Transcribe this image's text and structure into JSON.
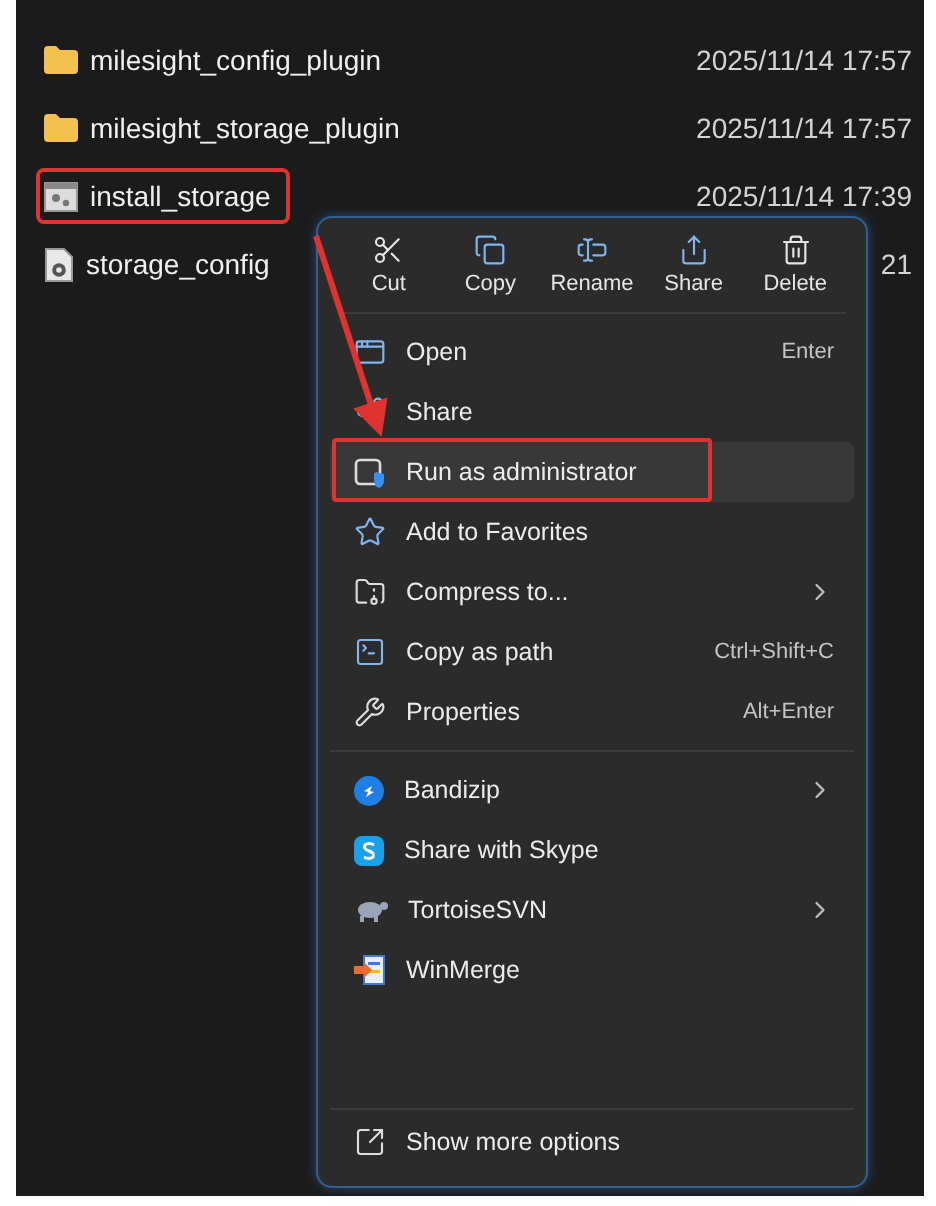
{
  "files": [
    {
      "name": "milesight_config_plugin",
      "date": "2025/11/14 17:57",
      "kind": "folder",
      "annotated": false
    },
    {
      "name": "milesight_storage_plugin",
      "date": "2025/11/14 17:57",
      "kind": "folder",
      "annotated": false
    },
    {
      "name": "install_storage",
      "date": "2025/11/14 17:39",
      "kind": "script",
      "annotated": true
    },
    {
      "name": "storage_config",
      "date": "21",
      "kind": "config",
      "annotated": false
    }
  ],
  "context_menu": {
    "actions": [
      {
        "label": "Cut",
        "kind": "cut"
      },
      {
        "label": "Copy",
        "kind": "copy"
      },
      {
        "label": "Rename",
        "kind": "rename"
      },
      {
        "label": "Share",
        "kind": "share"
      },
      {
        "label": "Delete",
        "kind": "delete"
      }
    ],
    "sections": [
      [
        {
          "label": "Open",
          "shortcut": "Enter",
          "kind": "open",
          "highlighted": false,
          "annotated": false,
          "submenu": false
        },
        {
          "label": "Share",
          "kind": "share",
          "highlighted": false,
          "annotated": false,
          "submenu": false
        },
        {
          "label": "Run as administrator",
          "kind": "admin",
          "highlighted": true,
          "annotated": true,
          "submenu": false
        },
        {
          "label": "Add to Favorites",
          "kind": "star",
          "highlighted": false,
          "annotated": false,
          "submenu": false
        },
        {
          "label": "Compress to...",
          "kind": "compress",
          "highlighted": false,
          "annotated": false,
          "submenu": true
        },
        {
          "label": "Copy as path",
          "shortcut": "Ctrl+Shift+C",
          "kind": "path",
          "highlighted": false,
          "annotated": false,
          "submenu": false
        },
        {
          "label": "Properties",
          "shortcut": "Alt+Enter",
          "kind": "properties",
          "highlighted": false,
          "annotated": false,
          "submenu": false
        }
      ],
      [
        {
          "label": "Bandizip",
          "kind": "bandizip",
          "highlighted": false,
          "annotated": false,
          "submenu": true
        },
        {
          "label": "Share with Skype",
          "kind": "skype",
          "highlighted": false,
          "annotated": false,
          "submenu": false
        },
        {
          "label": "TortoiseSVN",
          "kind": "tortoise",
          "highlighted": false,
          "annotated": false,
          "submenu": true
        },
        {
          "label": "WinMerge",
          "kind": "winmerge",
          "highlighted": false,
          "annotated": false,
          "submenu": false
        }
      ]
    ],
    "footer": {
      "label": "Show more options",
      "kind": "more"
    }
  }
}
